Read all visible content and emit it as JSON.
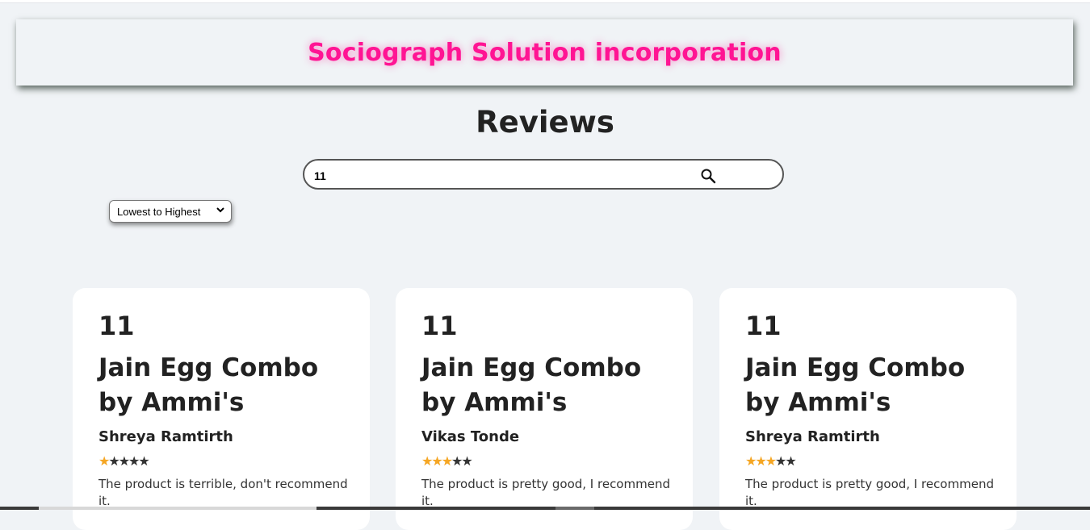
{
  "header": {
    "brand": "Sociograph Solution incorporation"
  },
  "page": {
    "title": "Reviews"
  },
  "search": {
    "value": "11",
    "icon": "search-icon"
  },
  "sort": {
    "selected": "Lowest to Highest"
  },
  "reviews": [
    {
      "id": "11",
      "product": "Jain Egg Combo by Ammi's",
      "author": "Shreya Ramtirth",
      "rating": 1,
      "max_rating": 5,
      "text": "The product is terrible, don't recommend it."
    },
    {
      "id": "11",
      "product": "Jain Egg Combo by Ammi's",
      "author": "Vikas Tonde",
      "rating": 3,
      "max_rating": 5,
      "text": "The product is pretty good, I recommend it."
    },
    {
      "id": "11",
      "product": "Jain Egg Combo by Ammi's",
      "author": "Shreya Ramtirth",
      "rating": 3,
      "max_rating": 5,
      "text": "The product is pretty good, I recommend it."
    }
  ],
  "colors": {
    "brand": "#ff1493",
    "star_on": "#f5a623",
    "star_off": "#333333",
    "background": "#f0f3f6"
  }
}
